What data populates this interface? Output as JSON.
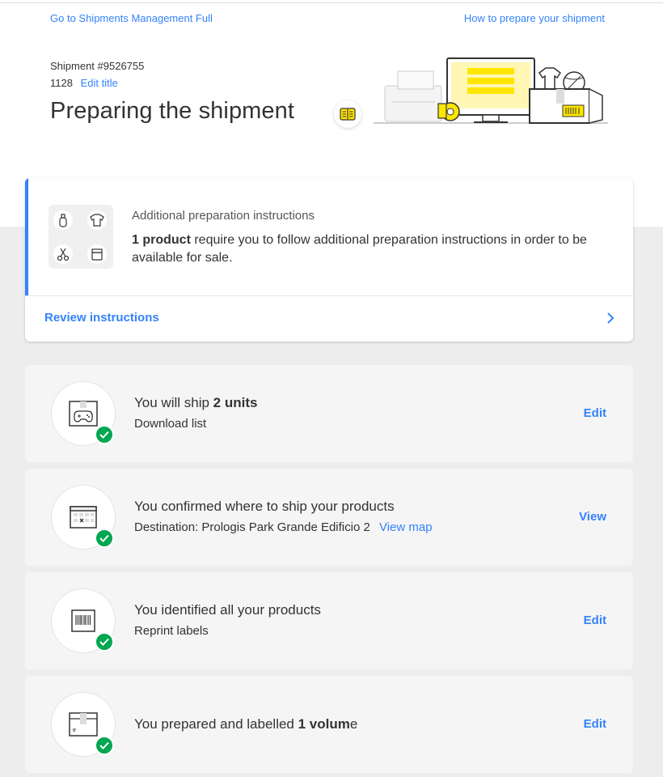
{
  "header": {
    "left_link": "Go to Shipments Management Full",
    "right_link": "How to prepare your shipment",
    "shipment_id": "Shipment #9526755",
    "shipment_number": "1128",
    "edit_title": "Edit title",
    "title": "Preparing the shipment"
  },
  "prep_card": {
    "heading": "Additional preparation instructions",
    "count_bold": "1 product",
    "text": " require you to follow additional preparation instructions in order to be available for sale.",
    "action": "Review instructions",
    "icons": [
      "bottle-icon",
      "tshirt-icon",
      "scissors-icon",
      "jar-icon"
    ]
  },
  "steps": [
    {
      "icon": "gamepad-box-icon",
      "text_pre": "You will ship ",
      "text_bold": "2 units",
      "text_post": "",
      "sub_link": "Download list",
      "action": "Edit"
    },
    {
      "icon": "calendar-icon",
      "text_pre": "You confirmed where to ship your products",
      "sub_text": "Destination: Prologis Park Grande Edificio 2",
      "sub_link": "View map",
      "action": "View"
    },
    {
      "icon": "barcode-icon",
      "text_pre": "You identified all your products",
      "sub_link": "Reprint labels",
      "action": "Edit"
    },
    {
      "icon": "box-icon",
      "text_pre": "You prepared and labelled ",
      "text_bold": "1 volum",
      "text_post": "e",
      "action": "Edit"
    }
  ],
  "colors": {
    "accent": "#3483fa",
    "success": "#00a650",
    "brand_yellow": "#ffe600"
  }
}
